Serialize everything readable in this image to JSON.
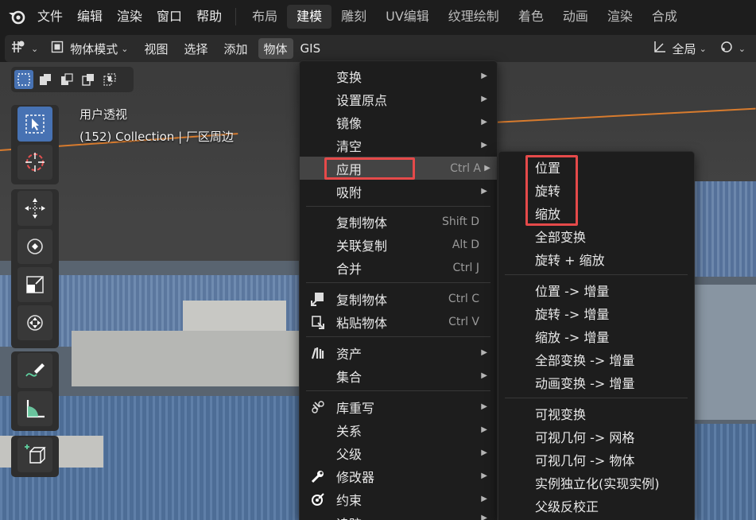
{
  "topbar": {
    "menus": [
      "文件",
      "编辑",
      "渲染",
      "窗口",
      "帮助"
    ],
    "workspaces": [
      "布局",
      "建模",
      "雕刻",
      "UV编辑",
      "纹理绘制",
      "着色",
      "动画",
      "渲染",
      "合成"
    ],
    "active_workspace": "建模"
  },
  "header": {
    "mode": "物体模式",
    "menus": [
      "视图",
      "选择",
      "添加",
      "物体",
      "GIS"
    ],
    "active_menu": "物体",
    "transform_orientation": "全局"
  },
  "viewport": {
    "view_name": "用户透视",
    "collection_info": "(152) Collection | 厂区周边"
  },
  "object_menu": {
    "items": [
      {
        "label": "变换",
        "shortcut": "",
        "submenu": true
      },
      {
        "label": "设置原点",
        "shortcut": "",
        "submenu": true
      },
      {
        "label": "镜像",
        "shortcut": "",
        "submenu": true
      },
      {
        "label": "清空",
        "shortcut": "",
        "submenu": true
      },
      {
        "label": "应用",
        "shortcut": "Ctrl A",
        "submenu": true
      },
      {
        "label": "吸附",
        "shortcut": "",
        "submenu": true
      },
      {
        "label": "复制物体",
        "shortcut": "Shift D",
        "submenu": false
      },
      {
        "label": "关联复制",
        "shortcut": "Alt D",
        "submenu": false
      },
      {
        "label": "合并",
        "shortcut": "Ctrl J",
        "submenu": false
      },
      {
        "label": "复制物体",
        "shortcut": "Ctrl C",
        "submenu": false
      },
      {
        "label": "粘贴物体",
        "shortcut": "Ctrl V",
        "submenu": false
      },
      {
        "label": "资产",
        "shortcut": "",
        "submenu": true
      },
      {
        "label": "集合",
        "shortcut": "",
        "submenu": true
      },
      {
        "label": "库重写",
        "shortcut": "",
        "submenu": true
      },
      {
        "label": "关系",
        "shortcut": "",
        "submenu": true
      },
      {
        "label": "父级",
        "shortcut": "",
        "submenu": true
      },
      {
        "label": "修改器",
        "shortcut": "",
        "submenu": true
      },
      {
        "label": "约束",
        "shortcut": "",
        "submenu": true
      },
      {
        "label": "追踪",
        "shortcut": "",
        "submenu": true
      }
    ]
  },
  "apply_submenu": {
    "items": [
      "位置",
      "旋转",
      "缩放",
      "全部变换",
      "旋转 + 缩放",
      "位置 -> 增量",
      "旋转 -> 增量",
      "缩放 -> 增量",
      "全部变换 -> 增量",
      "动画变换 -> 增量",
      "可视变换",
      "可视几何 -> 网格",
      "可视几何 -> 物体",
      "实例独立化(实现实例)",
      "父级反校正"
    ]
  },
  "colors": {
    "accent": "#4772b3",
    "highlight_box": "#e54a4a",
    "horizon": "#d77b2e"
  }
}
